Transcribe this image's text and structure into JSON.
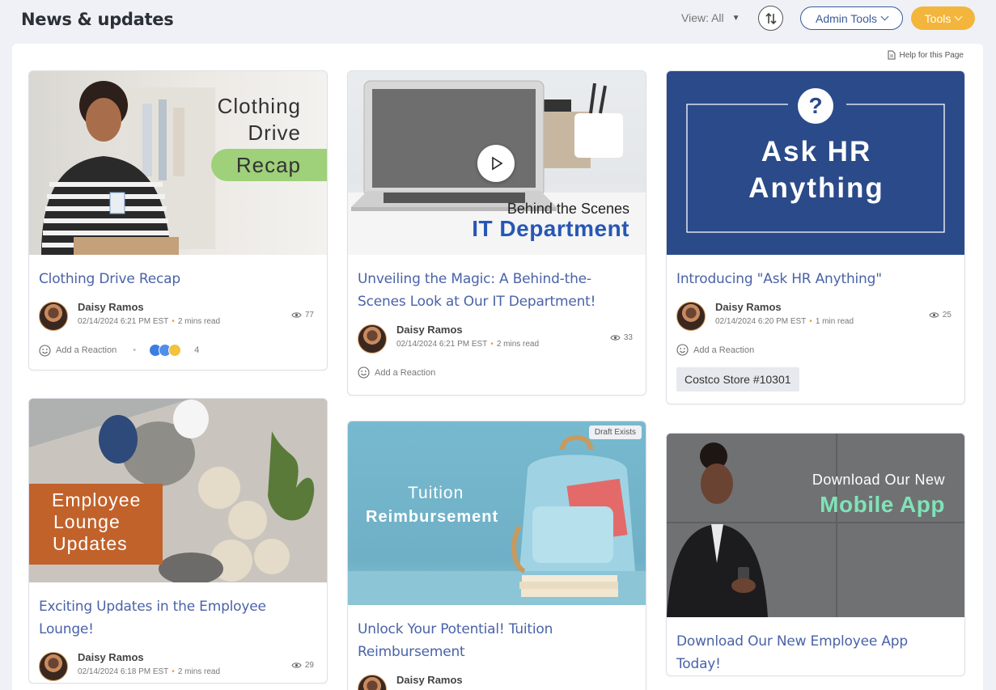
{
  "header": {
    "title": "News & updates",
    "view_label": "View: All",
    "admin_tools_label": "Admin Tools",
    "tools_label": "Tools"
  },
  "help_label": "Help for this Page",
  "colors": {
    "accent": "#3b5a9a",
    "tools": "#f3b53c",
    "link": "#4a63a8"
  },
  "cards": [
    {
      "title": "Clothing Drive Recap",
      "image_text": [
        "Clothing",
        "Drive",
        "Recap"
      ],
      "author": "Daisy Ramos",
      "date": "02/14/2024 6:21 PM EST",
      "read": "2 mins read",
      "views": "77",
      "reaction_label": "Add a Reaction",
      "reaction_count": "4"
    },
    {
      "title": "Unveiling the Magic: A Behind-the-Scenes Look at Our IT Department!",
      "image_text": [
        "Behind the Scenes",
        "IT Department"
      ],
      "author": "Daisy Ramos",
      "date": "02/14/2024 6:21 PM EST",
      "read": "2 mins read",
      "views": "33",
      "reaction_label": "Add a Reaction"
    },
    {
      "title": "Introducing \"Ask HR Anything\"",
      "image_text": [
        "Ask HR",
        "Anything"
      ],
      "author": "Daisy Ramos",
      "date": "02/14/2024 6:20 PM EST",
      "read": "1 min read",
      "views": "25",
      "reaction_label": "Add a Reaction",
      "tag": "Costco Store #10301"
    },
    {
      "title": "Exciting Updates in the Employee Lounge!",
      "image_text": [
        "Employee",
        "Lounge",
        "Updates"
      ],
      "author": "Daisy Ramos",
      "date": "02/14/2024 6:18 PM EST",
      "read": "2 mins read",
      "views": "29"
    },
    {
      "title": "Unlock Your Potential! Tuition Reimbursement",
      "image_text": [
        "Tuition",
        "Reimbursement"
      ],
      "badge": "Draft Exists",
      "author": "Daisy Ramos"
    },
    {
      "title": "Download Our New Employee App Today!",
      "image_text": [
        "Download Our New",
        "Mobile App"
      ]
    }
  ]
}
